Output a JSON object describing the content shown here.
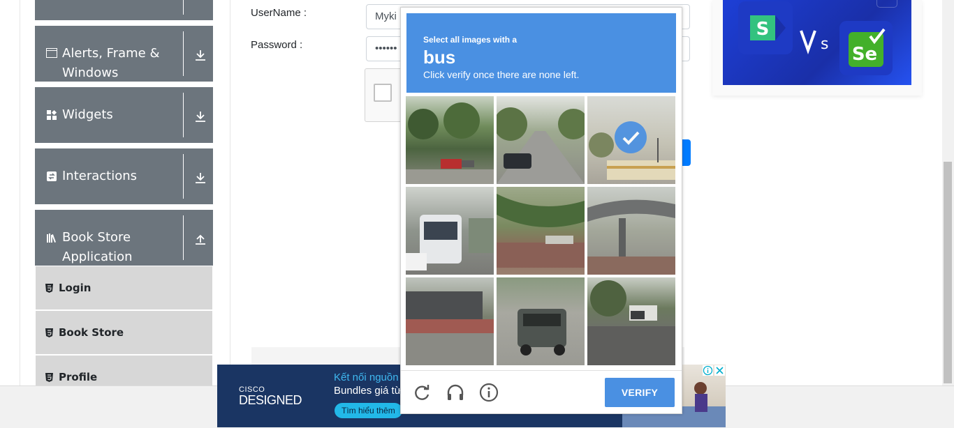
{
  "sidebar": {
    "groups": [
      {
        "label": ""
      },
      {
        "label_line1": "Alerts, Frame &",
        "label_line2": "Windows"
      },
      {
        "label": "Widgets"
      },
      {
        "label": "Interactions"
      },
      {
        "label_line1": "Book Store",
        "label_line2": "Application"
      }
    ],
    "items": [
      {
        "label": "Login"
      },
      {
        "label": "Book Store"
      },
      {
        "label": "Profile"
      }
    ]
  },
  "form": {
    "username_label": "UserName :",
    "username_value": "Myki",
    "password_label": "Password :",
    "password_value": "••••••"
  },
  "captcha": {
    "line1": "Select all images with a",
    "keyword": "bus",
    "line3": "Click verify once there are none left.",
    "verify_label": "VERIFY",
    "selected_cells": [
      3
    ]
  },
  "ad": {
    "brand_top": "CISCO",
    "brand_main": "DESIGNED",
    "headline": "Kết nối nguồn",
    "subline": "Bundles giá từ",
    "cta": "Tìm hiểu thêm"
  },
  "colors": {
    "captcha_blue": "#4a90e2",
    "sidebar_grey": "#6c757d",
    "primary_blue": "#007bff"
  }
}
